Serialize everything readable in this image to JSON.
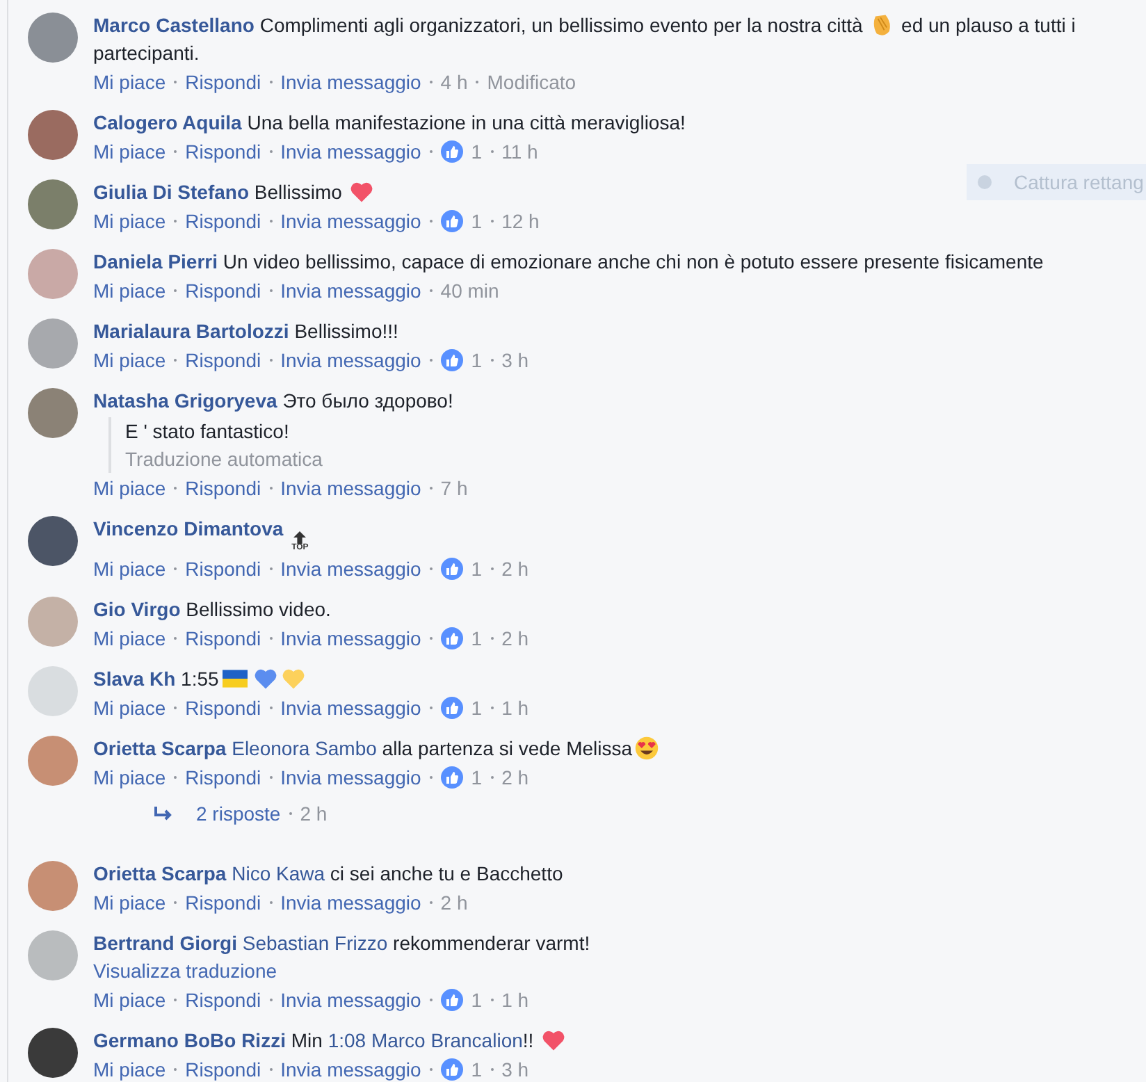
{
  "overlay": {
    "label": "Cattura rettang"
  },
  "comments": [
    {
      "author": "Marco Castellano",
      "body": [
        {
          "kind": "text",
          "text": "Complimenti agli organizzatori, un bellissimo evento per la nostra città "
        },
        {
          "kind": "clap"
        },
        {
          "kind": "text",
          "text": " ed un plauso a tutti i partecipanti."
        }
      ],
      "actions": {
        "like": "Mi piace",
        "reply": "Rispondi",
        "message": "Invia messaggio",
        "time": "4 h",
        "edited": "Modificato"
      }
    },
    {
      "author": "Calogero Aquila",
      "body": [
        {
          "kind": "text",
          "text": "Una bella manifestazione in una città meravigliosa!"
        }
      ],
      "actions": {
        "like": "Mi piace",
        "reply": "Rispondi",
        "message": "Invia messaggio",
        "likes": "1",
        "time": "11 h"
      }
    },
    {
      "author": "Giulia Di Stefano",
      "body": [
        {
          "kind": "text",
          "text": "Bellissimo "
        },
        {
          "kind": "heart",
          "color": "#f25268"
        }
      ],
      "actions": {
        "like": "Mi piace",
        "reply": "Rispondi",
        "message": "Invia messaggio",
        "likes": "1",
        "time": "12 h"
      }
    },
    {
      "author": "Daniela Pierri",
      "body": [
        {
          "kind": "text",
          "text": "Un video bellissimo, capace di emozionare anche chi non è potuto essere presente fisicamente"
        }
      ],
      "actions": {
        "like": "Mi piace",
        "reply": "Rispondi",
        "message": "Invia messaggio",
        "time": "40 min"
      }
    },
    {
      "author": "Marialaura Bartolozzi",
      "body": [
        {
          "kind": "text",
          "text": "Bellissimo!!!"
        }
      ],
      "actions": {
        "like": "Mi piace",
        "reply": "Rispondi",
        "message": "Invia messaggio",
        "likes": "1",
        "time": "3 h"
      }
    },
    {
      "author": "Natasha Grigoryeva",
      "body": [
        {
          "kind": "text",
          "text": "Это было здорово!"
        }
      ],
      "translation": {
        "text": "E ' stato fantastico!",
        "note": "Traduzione automatica"
      },
      "actions": {
        "like": "Mi piace",
        "reply": "Rispondi",
        "message": "Invia messaggio",
        "time": "7 h"
      }
    },
    {
      "author": "Vincenzo Dimantova",
      "body": [
        {
          "kind": "top_badge",
          "text": "TOP"
        }
      ],
      "actions": {
        "like": "Mi piace",
        "reply": "Rispondi",
        "message": "Invia messaggio",
        "likes": "1",
        "time": "2 h"
      }
    },
    {
      "author": "Gio Virgo",
      "body": [
        {
          "kind": "text",
          "text": "Bellissimo video."
        }
      ],
      "actions": {
        "like": "Mi piace",
        "reply": "Rispondi",
        "message": "Invia messaggio",
        "likes": "1",
        "time": "2 h"
      }
    },
    {
      "author": "Slava Kh",
      "body": [
        {
          "kind": "text",
          "text": "1:55"
        },
        {
          "kind": "flag"
        },
        {
          "kind": "heart",
          "color": "#5b8def"
        },
        {
          "kind": "heart",
          "color": "#fcd15c"
        }
      ],
      "actions": {
        "like": "Mi piace",
        "reply": "Rispondi",
        "message": "Invia messaggio",
        "likes": "1",
        "time": "1 h"
      }
    },
    {
      "author": "Orietta Scarpa",
      "body": [
        {
          "kind": "mention",
          "text": "Eleonora Sambo"
        },
        {
          "kind": "text",
          "text": " alla partenza si vede Melissa"
        },
        {
          "kind": "heart_eyes"
        }
      ],
      "actions": {
        "like": "Mi piace",
        "reply": "Rispondi",
        "message": "Invia messaggio",
        "likes": "1",
        "time": "2 h"
      },
      "replies": {
        "label": "2 risposte",
        "time": "2 h"
      }
    },
    {
      "author": "Orietta Scarpa",
      "body": [
        {
          "kind": "mention",
          "text": "Nico Kawa"
        },
        {
          "kind": "text",
          "text": " ci sei anche tu e Bacchetto"
        }
      ],
      "actions": {
        "like": "Mi piace",
        "reply": "Rispondi",
        "message": "Invia messaggio",
        "time": "2 h"
      }
    },
    {
      "author": "Bertrand Giorgi",
      "body": [
        {
          "kind": "mention",
          "text": "Sebastian Frizzo"
        },
        {
          "kind": "text",
          "text": " rekommenderar varmt!"
        }
      ],
      "see_translation": "Visualizza traduzione",
      "actions": {
        "like": "Mi piace",
        "reply": "Rispondi",
        "message": "Invia messaggio",
        "likes": "1",
        "time": "1 h"
      }
    },
    {
      "author": "Germano BoBo Rizzi",
      "body": [
        {
          "kind": "text",
          "text": "Min "
        },
        {
          "kind": "mention",
          "text": "1:08 Marco Brancalion"
        },
        {
          "kind": "text",
          "text": "!! "
        },
        {
          "kind": "heart",
          "color": "#f25268"
        }
      ],
      "actions": {
        "like": "Mi piace",
        "reply": "Rispondi",
        "message": "Invia messaggio",
        "likes": "1",
        "time": "3 h"
      }
    }
  ]
}
